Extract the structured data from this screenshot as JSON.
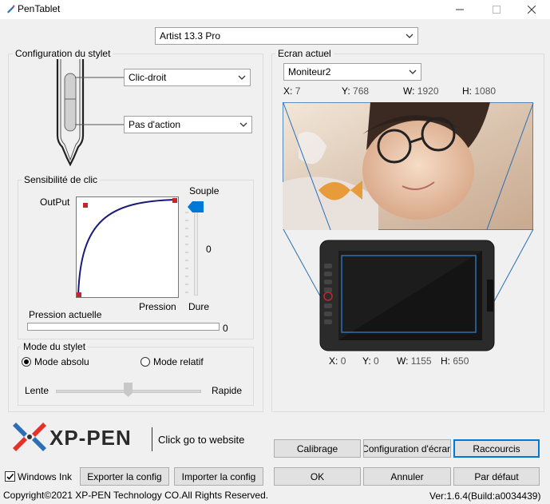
{
  "window": {
    "title": "PenTablet",
    "icon": "pen-tablet-icon",
    "minimize_icon": "minimize-icon",
    "maximize_icon": "maximize-icon",
    "close_icon": "close-icon"
  },
  "device_select": {
    "value": "Artist 13.3 Pro"
  },
  "stylus_config": {
    "label": "Configuration du stylet",
    "upper_button": "Clic-droit",
    "lower_button": "Pas d'action"
  },
  "sensitivity": {
    "label": "Sensibilité de clic",
    "output_label": "OutPut",
    "pressure_label": "Pression",
    "soft_label": "Souple",
    "hard_label": "Dure",
    "slider_value": "0",
    "current_pressure_label": "Pression actuelle",
    "current_pressure_value": "0",
    "current_pressure_fraction": 0
  },
  "stylus_mode": {
    "label": "Mode du stylet",
    "absolute_label": "Mode absolu",
    "relative_label": "Mode relatif",
    "selected": "absolute",
    "slow_label": "Lente",
    "fast_label": "Rapide",
    "speed_fraction": 0.5
  },
  "screen": {
    "label": "Ecran actuel",
    "monitor": "Moniteur2",
    "x_label": "X:",
    "x": "7",
    "y_label": "Y:",
    "y": "768",
    "w_label": "W:",
    "w": "1920",
    "h_label": "H:",
    "h": "1080"
  },
  "tablet": {
    "x_label": "X:",
    "x": "0",
    "y_label": "Y:",
    "y": "0",
    "w_label": "W:",
    "w": "1155",
    "h_label": "H:",
    "h": "650"
  },
  "brand": {
    "logo_text": "XP-PEN",
    "website_text": "Click go to website"
  },
  "buttons": {
    "calibrate": "Calibrage",
    "screen_config": "Configuration d'écran",
    "shortcuts": "Raccourcis",
    "ok": "OK",
    "cancel": "Annuler",
    "default": "Par défaut",
    "export": "Exporter la config",
    "import": "Importer la config"
  },
  "windows_ink": {
    "label": "Windows Ink",
    "checked": true
  },
  "footer": {
    "copyright": "Copyright©2021  XP-PEN Technology CO.All Rights Reserved.",
    "version": "Ver:1.6.4(Build:a0034439)"
  },
  "colors": {
    "accent": "#0078d7",
    "curve": "#1a1a7a",
    "curve_point": "#c0282c",
    "brand_red": "#e4322b",
    "brand_blue": "#2a6fb7"
  }
}
